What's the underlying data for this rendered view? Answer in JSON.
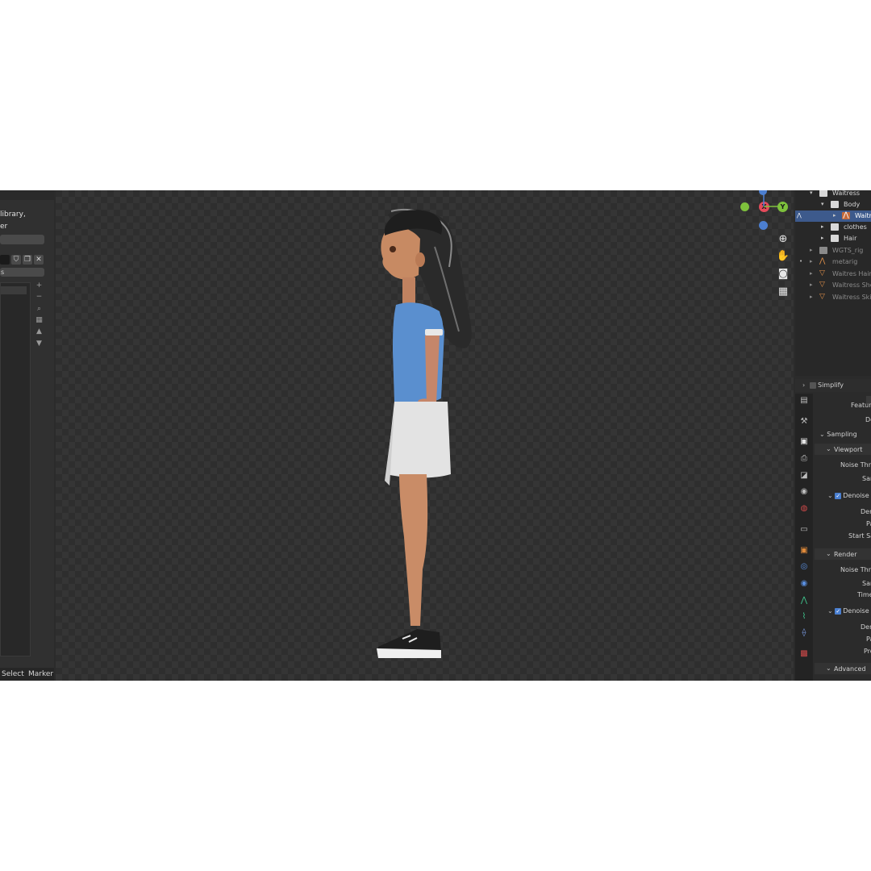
{
  "left_panel": {
    "line1": "library,",
    "line2": "er",
    "field_suffix": "s",
    "mini_buttons": [
      "shield-icon",
      "copy-icon",
      "close-icon"
    ],
    "side_buttons": [
      "+",
      "−",
      "⌕",
      "▦",
      "▲",
      "▼"
    ]
  },
  "timeline": {
    "select": "Select",
    "marker": "Marker"
  },
  "viewport": {
    "gizmo": {
      "x": "X",
      "y": "Y"
    },
    "nav": [
      "zoom-icon",
      "hand-icon",
      "camera-icon",
      "grid-icon"
    ]
  },
  "outliner": {
    "rows": [
      {
        "label": "Waitress",
        "type": "collection",
        "indent": 0,
        "expanded": true
      },
      {
        "label": "Body",
        "type": "collection",
        "indent": 1,
        "expanded": true
      },
      {
        "label": "Waitr",
        "type": "armature",
        "indent": 2,
        "expanded": false,
        "selected": true
      },
      {
        "label": "clothes",
        "type": "collection",
        "indent": 1,
        "expanded": false
      },
      {
        "label": "Hair",
        "type": "collection",
        "indent": 1,
        "expanded": false
      },
      {
        "label": "WGTS_rig",
        "type": "collection",
        "indent": 0,
        "expanded": false,
        "faded": true
      },
      {
        "label": "metarig",
        "type": "armature",
        "indent": 0,
        "expanded": false,
        "faded": true
      },
      {
        "label": "Waitres Hair",
        "type": "mesh",
        "indent": 0,
        "expanded": false,
        "faded": true
      },
      {
        "label": "Waitress Shoe",
        "type": "mesh",
        "indent": 0,
        "expanded": false,
        "faded": true
      },
      {
        "label": "Waitress Skin",
        "type": "mesh",
        "indent": 0,
        "expanded": false,
        "faded": true
      }
    ]
  },
  "properties": {
    "simplify": "Simplify",
    "feature": "Feature",
    "de": "De",
    "sampling": "Sampling",
    "viewport": "Viewport",
    "noise_thre_1": "Noise Thre",
    "sar_1": "Sar",
    "denoise_1": "Denoise",
    "den_1": "Den",
    "pa_1": "Pa",
    "start_sa": "Start Sa",
    "render": "Render",
    "noise_thre_2": "Noise Thre",
    "sar_2": "Sar",
    "time": "Time",
    "denoise_2": "Denoise",
    "den_2": "Den",
    "pa_2": "Pa",
    "pre": "Pre",
    "advanced": "Advanced",
    "tabs": [
      "tool-icon",
      "render-icon",
      "output-icon",
      "view-layer-icon",
      "scene-icon",
      "world-icon",
      "collection-icon",
      "object-icon",
      "modifier-icon",
      "particles-icon",
      "physics-icon",
      "constraints-icon",
      "data-icon",
      "texture-icon"
    ]
  }
}
